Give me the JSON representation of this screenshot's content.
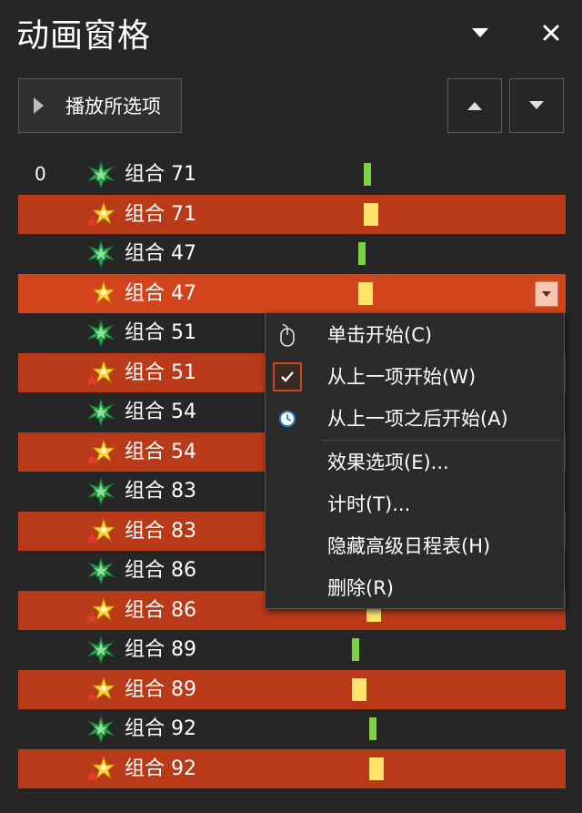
{
  "pane": {
    "title": "动画窗格",
    "play_label": "播放所选项",
    "colors": {
      "accent": "#d2441b",
      "selected_row": "#b83a18",
      "entry_bar": "#7cd145",
      "emphasis_bar": "#ffe36b"
    }
  },
  "rows": [
    {
      "num": "0",
      "type": "entrance",
      "label": "组合 71",
      "bar": 0.0
    },
    {
      "num": "",
      "type": "emphasis",
      "label": "组合 71",
      "bar": 0.0
    },
    {
      "num": "",
      "type": "entrance",
      "label": "组合 47",
      "bar": -0.6
    },
    {
      "num": "",
      "type": "emphasis",
      "label": "组合 47",
      "bar": -0.6
    },
    {
      "num": "",
      "type": "entrance",
      "label": "组合 51",
      "bar": 0
    },
    {
      "num": "",
      "type": "emphasis",
      "label": "组合 51",
      "bar": 0
    },
    {
      "num": "",
      "type": "entrance",
      "label": "组合 54",
      "bar": 0
    },
    {
      "num": "",
      "type": "emphasis",
      "label": "组合 54",
      "bar": 0
    },
    {
      "num": "",
      "type": "entrance",
      "label": "组合 83",
      "bar": 0
    },
    {
      "num": "",
      "type": "emphasis",
      "label": "组合 83",
      "bar": 0
    },
    {
      "num": "",
      "type": "entrance",
      "label": "组合 86",
      "bar": 0
    },
    {
      "num": "",
      "type": "emphasis",
      "label": "组合 86",
      "bar": 0.3
    },
    {
      "num": "",
      "type": "entrance",
      "label": "组合 89",
      "bar": -1.3
    },
    {
      "num": "",
      "type": "emphasis",
      "label": "组合 89",
      "bar": -1.3
    },
    {
      "num": "",
      "type": "entrance",
      "label": "组合 92",
      "bar": 0.6
    },
    {
      "num": "",
      "type": "emphasis",
      "label": "组合 92",
      "bar": 0.6
    }
  ],
  "menu": {
    "items": [
      {
        "label": "单击开始(C)",
        "icon": "mouse-icon",
        "checked": false
      },
      {
        "label": "从上一项开始(W)",
        "icon": "check-icon",
        "checked": true
      },
      {
        "label": "从上一项之后开始(A)",
        "icon": "clock-icon",
        "checked": false
      },
      {
        "label": "效果选项(E)...",
        "icon": "",
        "checked": false
      },
      {
        "label": "计时(T)...",
        "icon": "",
        "checked": false
      },
      {
        "label": "隐藏高级日程表(H)",
        "icon": "",
        "checked": false
      },
      {
        "label": "删除(R)",
        "icon": "",
        "checked": false
      }
    ]
  }
}
